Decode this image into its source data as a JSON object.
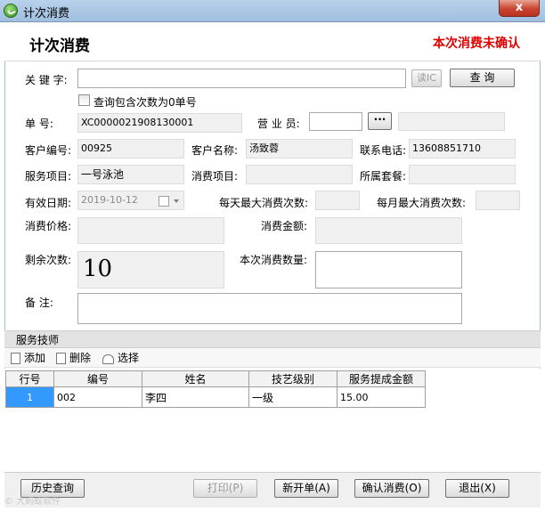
{
  "window": {
    "title": "计次消费",
    "close_label": "x"
  },
  "header": {
    "title": "计次消费",
    "status": "本次消费未确认"
  },
  "form": {
    "keyword_label": "关 键 字:",
    "keyword_value": "",
    "read_ic_label": "读IC",
    "query_label": "查 询",
    "zero_checkbox_label": "查询包含次数为0单号",
    "order_no_label": "单     号:",
    "order_no_value": "XC0000021908130001",
    "staff_label": "营 业 员:",
    "staff_value": "",
    "staff_browse_label": "···",
    "staff_name_value": "",
    "customer_no_label": "客户编号:",
    "customer_no_value": "00925",
    "customer_name_label": "客户名称:",
    "customer_name_value": "汤致蓉",
    "phone_label": "联系电话:",
    "phone_value": "13608851710",
    "service_label": "服务项目:",
    "service_value": "一号泳池",
    "consume_item_label": "消费项目:",
    "consume_item_value": "",
    "package_label": "所属套餐:",
    "package_value": "",
    "valid_date_label": "有效日期:",
    "valid_date_value": "2019-10-12",
    "daily_max_label": "每天最大消费次数:",
    "daily_max_value": "",
    "monthly_max_label": "每月最大消费次数:",
    "monthly_max_value": "",
    "price_label": "消费价格:",
    "price_value": "",
    "amount_label": "消费金额:",
    "amount_value": "",
    "remaining_label": "剩余次数:",
    "remaining_value": "10",
    "qty_label": "本次消费数量:",
    "qty_value": "",
    "remark_label": "备     注:",
    "remark_value": ""
  },
  "technicians": {
    "section_title": "服务技师",
    "toolbar": {
      "add": "添加",
      "delete": "删除",
      "select": "选择"
    },
    "columns": [
      "行号",
      "编号",
      "姓名",
      "技艺级别",
      "服务提成金额"
    ],
    "rows": [
      {
        "row_no": "1",
        "code": "002",
        "name": "李四",
        "level": "一级",
        "commission": "15.00"
      }
    ]
  },
  "footer": {
    "history": "历史查询",
    "print": "打印(P)",
    "new": "新开单(A)",
    "confirm": "确认消费(O)",
    "exit": "退出(X)",
    "watermark": "© 大蚂蚁软件"
  }
}
